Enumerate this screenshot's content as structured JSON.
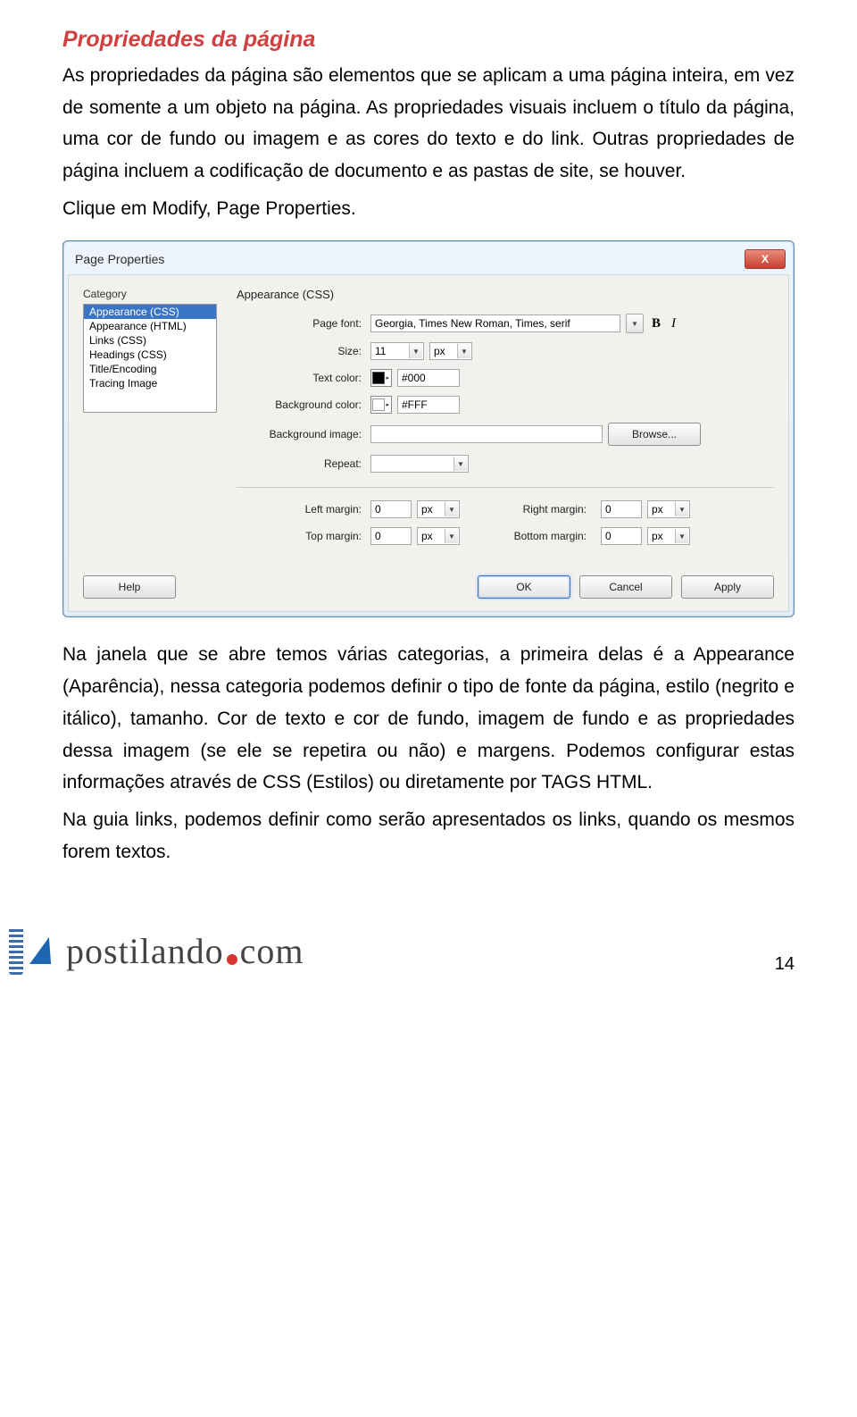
{
  "heading": "Propriedades da página",
  "para1": "As propriedades da página são elementos que se aplicam a uma página inteira, em vez de somente a um objeto na página. As propriedades visuais incluem o título da página, uma cor de fundo ou imagem e as cores do texto e do link. Outras propriedades de página incluem a codificação de documento e as pastas de site, se houver.",
  "para2": "Clique em Modify, Page Properties.",
  "dialog": {
    "title": "Page Properties",
    "close": "X",
    "category_label": "Category",
    "panel_title": "Appearance (CSS)",
    "categories": [
      "Appearance (CSS)",
      "Appearance (HTML)",
      "Links (CSS)",
      "Headings (CSS)",
      "Title/Encoding",
      "Tracing Image"
    ],
    "labels": {
      "page_font": "Page font:",
      "size": "Size:",
      "text_color": "Text color:",
      "bg_color": "Background color:",
      "bg_image": "Background image:",
      "repeat": "Repeat:",
      "left_margin": "Left margin:",
      "right_margin": "Right margin:",
      "top_margin": "Top margin:",
      "bottom_margin": "Bottom margin:"
    },
    "values": {
      "page_font": "Georgia, Times New Roman, Times, serif",
      "size": "11",
      "size_unit": "px",
      "text_color": "#000",
      "bg_color": "#FFF",
      "bg_image": "",
      "repeat": "",
      "left_margin": "0",
      "right_margin": "0",
      "top_margin": "0",
      "bottom_margin": "0",
      "margin_unit": "px"
    },
    "buttons": {
      "browse": "Browse...",
      "help": "Help",
      "ok": "OK",
      "cancel": "Cancel",
      "apply": "Apply"
    },
    "bold": "B",
    "italic": "I"
  },
  "para3": "Na janela que se abre temos várias categorias, a primeira delas é a Appearance (Aparência), nessa categoria podemos definir o tipo de fonte da página, estilo (negrito e itálico), tamanho. Cor de texto e cor de fundo, imagem de fundo e as propriedades dessa imagem (se ele se repetira ou não) e margens. Podemos configurar estas informações através de CSS (Estilos) ou diretamente por TAGS HTML.",
  "para4": "Na guia links, podemos definir como serão apresentados os links, quando os mesmos forem textos.",
  "logo": {
    "part1": "postilando",
    "part2": "com"
  },
  "page_number": "14"
}
